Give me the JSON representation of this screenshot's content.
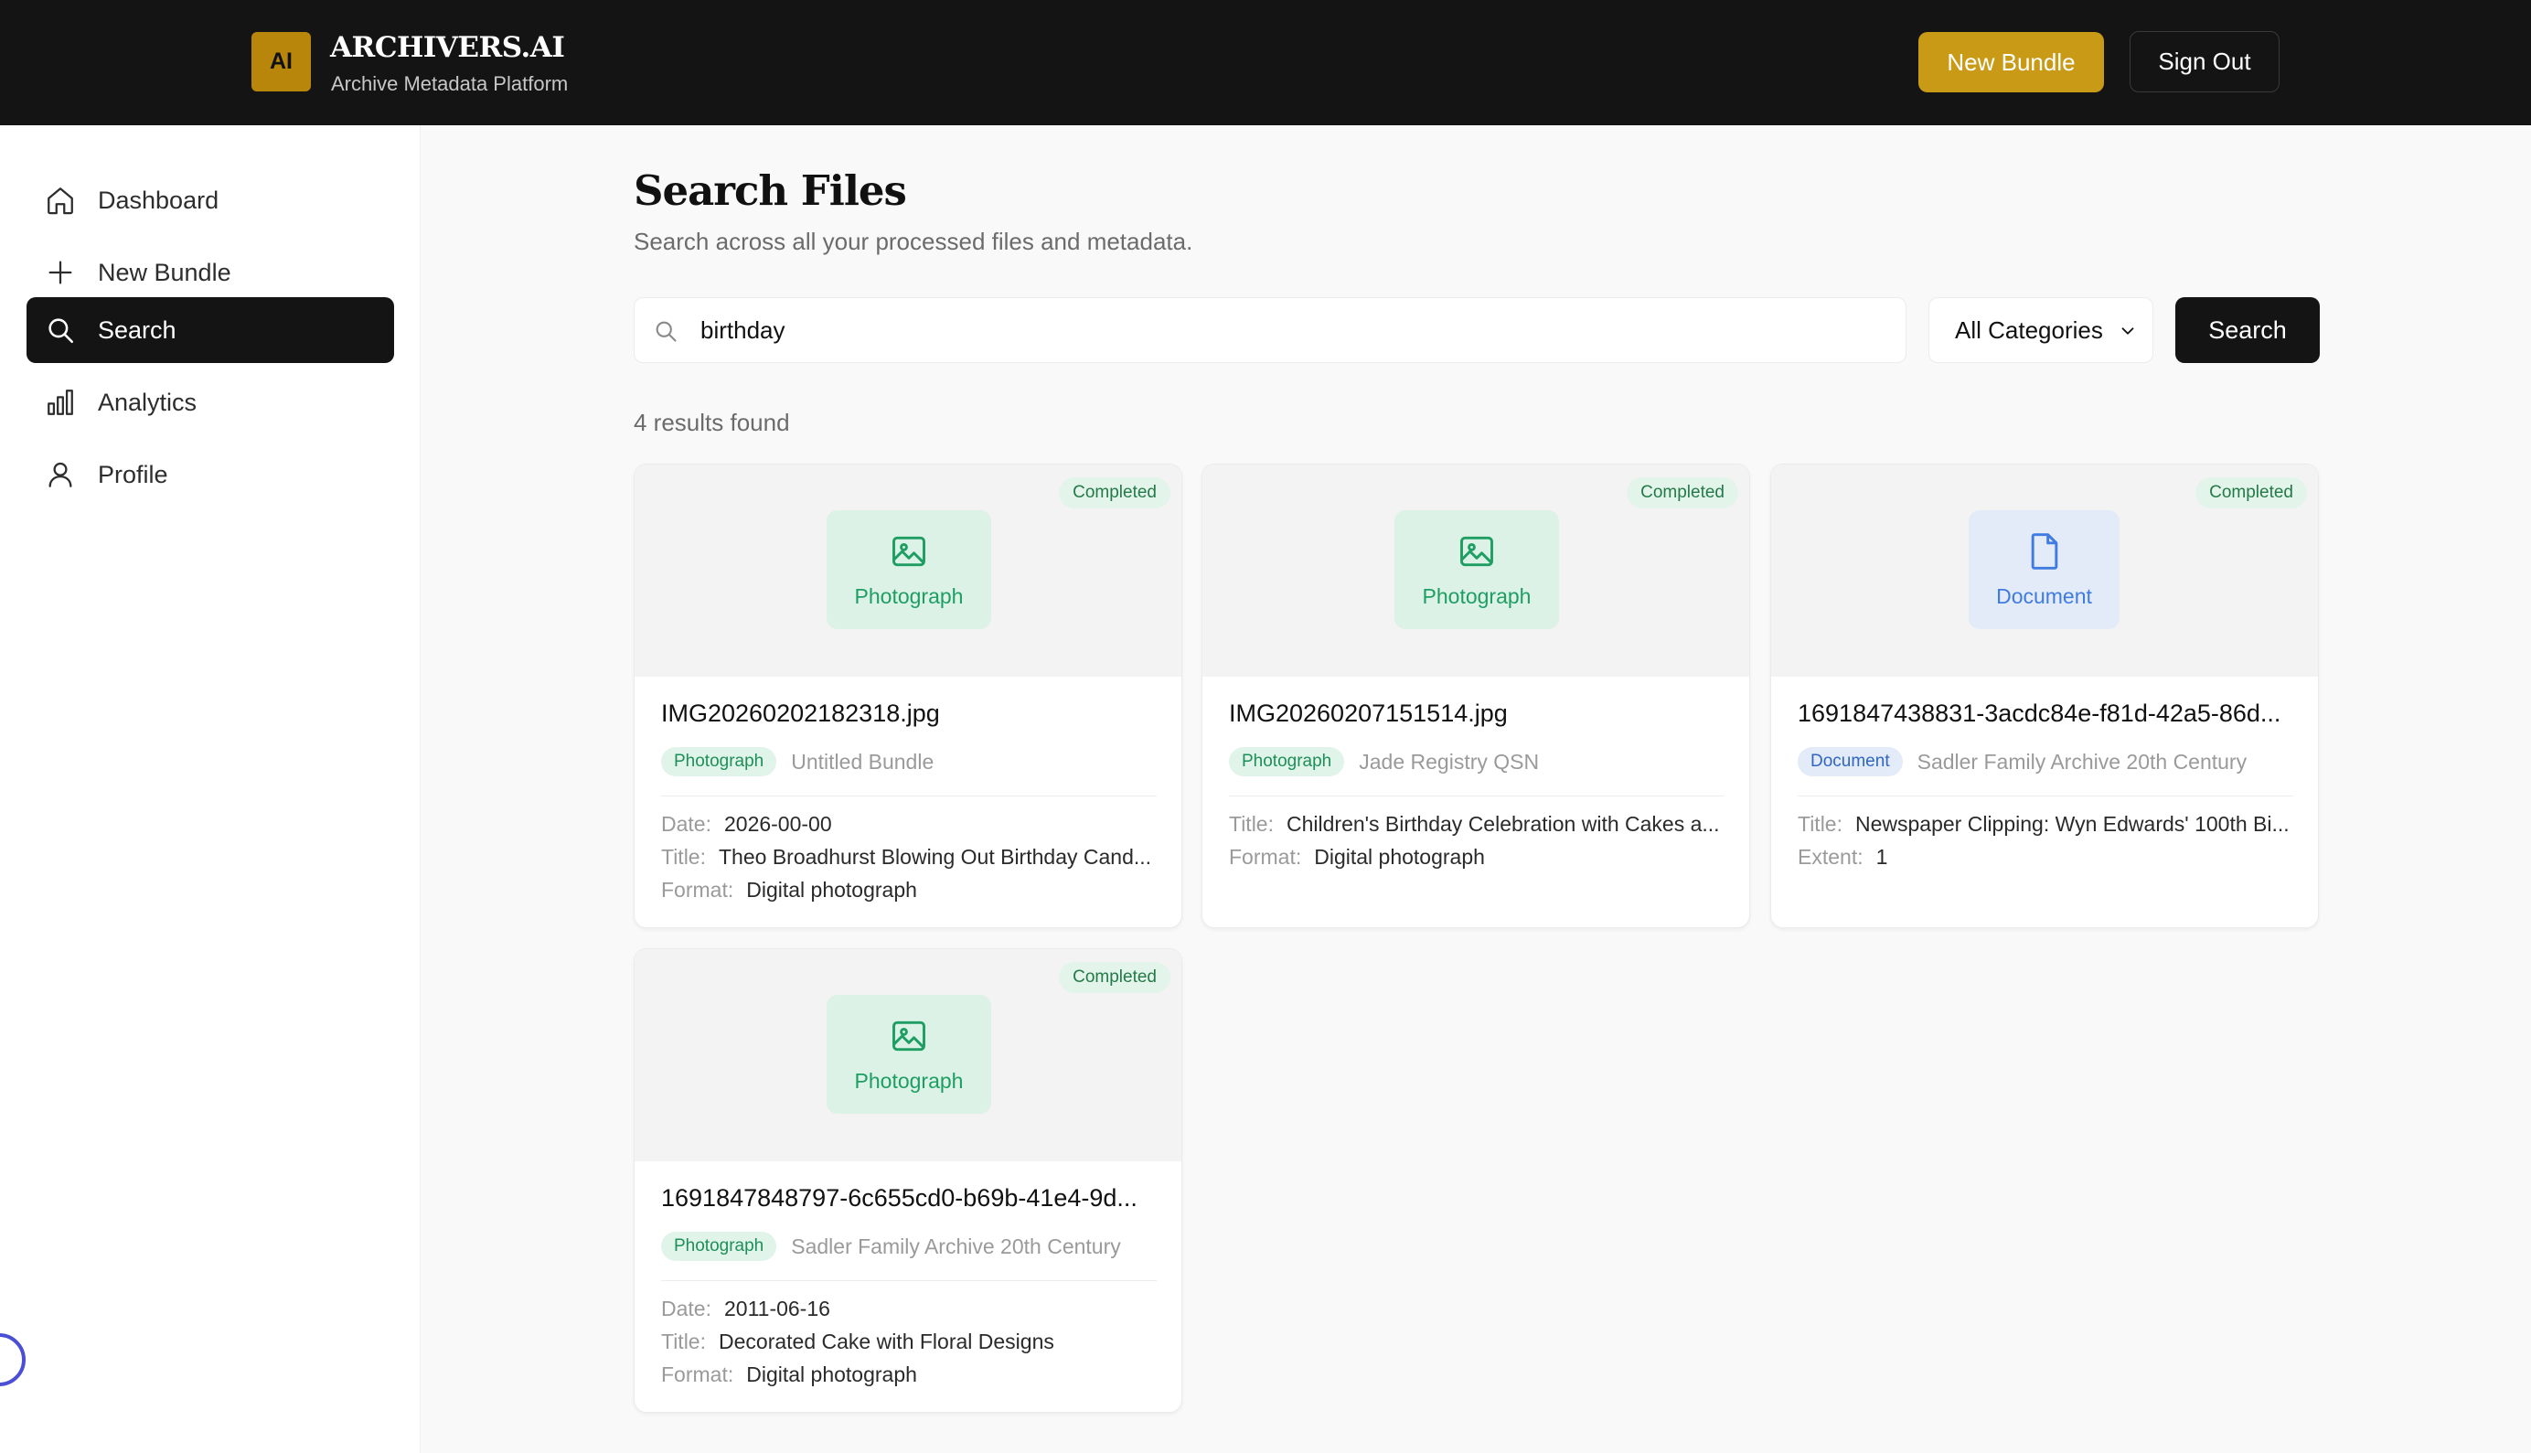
{
  "header": {
    "logo_text": "AI",
    "brand_name": "ARCHIVERS.AI",
    "brand_subtitle": "Archive Metadata Platform",
    "new_bundle_label": "New Bundle",
    "sign_out_label": "Sign Out"
  },
  "sidebar": {
    "items": [
      {
        "label": "Dashboard",
        "icon": "home-icon",
        "active": false
      },
      {
        "label": "New Bundle",
        "icon": "plus-icon",
        "active": false
      },
      {
        "label": "Search",
        "icon": "search-icon",
        "active": true
      },
      {
        "label": "Analytics",
        "icon": "bar-chart-icon",
        "active": false
      },
      {
        "label": "Profile",
        "icon": "user-icon",
        "active": false
      }
    ]
  },
  "main": {
    "title": "Search Files",
    "subtitle": "Search across all your processed files and metadata.",
    "search": {
      "value": "birthday",
      "placeholder": ""
    },
    "category_select": {
      "selected": "All Categories"
    },
    "search_button_label": "Search",
    "results_count": "4 results found",
    "results": [
      {
        "status": "Completed",
        "type": "Photograph",
        "file_name": "IMG20260202182318.jpg",
        "bundle": "Untitled Bundle",
        "meta": [
          {
            "label": "Date:",
            "value": "2026-00-00"
          },
          {
            "label": "Title:",
            "value": "Theo Broadhurst Blowing Out Birthday Cand..."
          },
          {
            "label": "Format:",
            "value": "Digital photograph"
          }
        ]
      },
      {
        "status": "Completed",
        "type": "Photograph",
        "file_name": "IMG20260207151514.jpg",
        "bundle": "Jade Registry QSN",
        "meta": [
          {
            "label": "Title:",
            "value": "Children's Birthday Celebration with Cakes a..."
          },
          {
            "label": "Format:",
            "value": "Digital photograph"
          }
        ]
      },
      {
        "status": "Completed",
        "type": "Document",
        "file_name": "1691847438831-3acdc84e-f81d-42a5-86d...",
        "bundle": "Sadler Family Archive 20th Century",
        "meta": [
          {
            "label": "Title:",
            "value": "Newspaper Clipping: Wyn Edwards' 100th Bi..."
          },
          {
            "label": "Extent:",
            "value": "1"
          }
        ]
      },
      {
        "status": "Completed",
        "type": "Photograph",
        "file_name": "1691847848797-6c655cd0-b69b-41e4-9d...",
        "bundle": "Sadler Family Archive 20th Century",
        "meta": [
          {
            "label": "Date:",
            "value": "2011-06-16"
          },
          {
            "label": "Title:",
            "value": "Decorated Cake with Floral Designs"
          },
          {
            "label": "Format:",
            "value": "Digital photograph"
          }
        ]
      }
    ]
  },
  "colors": {
    "header_bg": "#141414",
    "accent_gold": "#c99a16",
    "active_nav_bg": "#141414",
    "photo_green": "#1e9e63",
    "document_blue": "#3f7be0",
    "status_green": "#237a48"
  }
}
